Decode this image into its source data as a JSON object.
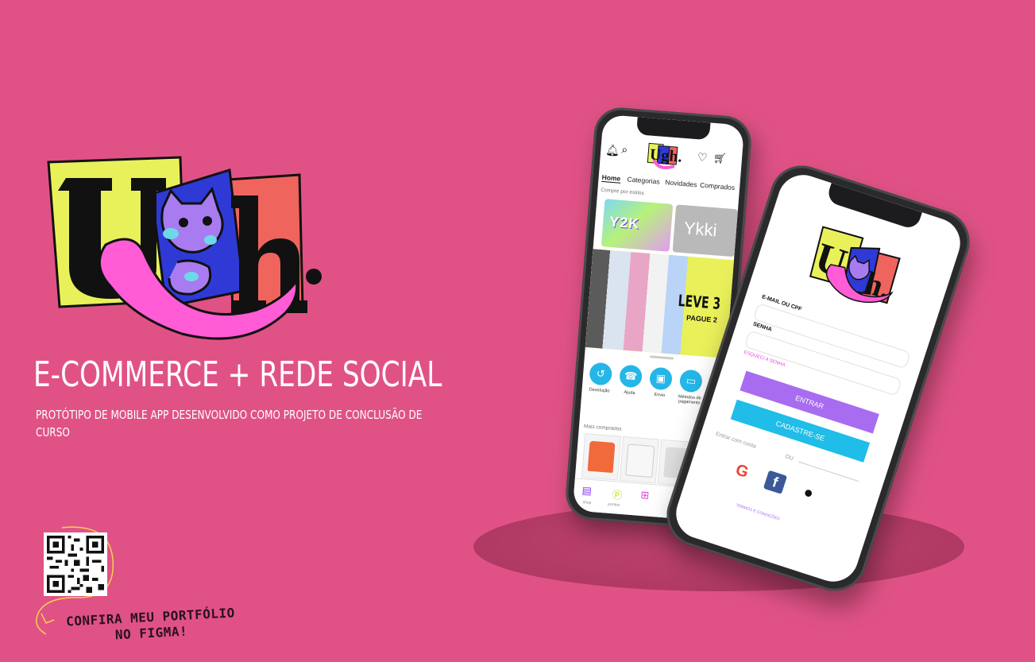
{
  "brand": {
    "logo_text": "Ugh.",
    "colors": {
      "background": "#e05286",
      "logo_yellow": "#e9f15a",
      "logo_blue": "#2f3ad6",
      "logo_coral": "#f0645e",
      "logo_tongue": "#ff5cd6",
      "accent_purple": "#a86cf0",
      "accent_cyan": "#1fbde8"
    }
  },
  "headline": "E-COMMERCE + REDE SOCIAL",
  "subtitle": "PROTÓTIPO DE MOBILE APP DESENVOLVIDO COMO PROJETO DE CONCLUSÃO DE CURSO",
  "qr": {
    "icon": "qr-code-icon",
    "cta_line1": "CONFIRA MEU PORTFÓLIO",
    "cta_line2": "NO FIGMA!"
  },
  "app_home": {
    "tabs": [
      "Home",
      "Categorias",
      "Novidades",
      "Comprados"
    ],
    "active_tab": 0,
    "section_styles": "Compre por estilos",
    "banner_1": "Y2K",
    "banner_2": "Ykki",
    "promo_title": "LEVE 3",
    "promo_sub": "PAGUE 2",
    "shortcuts": [
      {
        "label": "Devolução",
        "icon": "truck-icon"
      },
      {
        "label": "Ajuda",
        "icon": "headset-icon"
      },
      {
        "label": "Envio",
        "icon": "box-icon"
      },
      {
        "label": "Métodos de pagamento",
        "icon": "card-icon"
      }
    ],
    "section_most_bought": "Mais comprados",
    "nav": [
      {
        "label": "shop",
        "icon": "bag-icon"
      },
      {
        "label": "pontos",
        "icon": "coin-icon"
      },
      {
        "label": "",
        "icon": "plus-icon"
      }
    ]
  },
  "app_login": {
    "email_label": "E-MAIL OU CPF",
    "password_label": "SENHA",
    "forgot": "ESQUECI A SENHA",
    "enter_button": "ENTRAR",
    "signup_button": "CADASTRE-SE",
    "login_with": "Entrar com conta",
    "or": "OU",
    "terms": "TERMOS E CONDIÇÕES",
    "social": [
      "google-icon",
      "facebook-icon",
      "apple-icon"
    ]
  }
}
